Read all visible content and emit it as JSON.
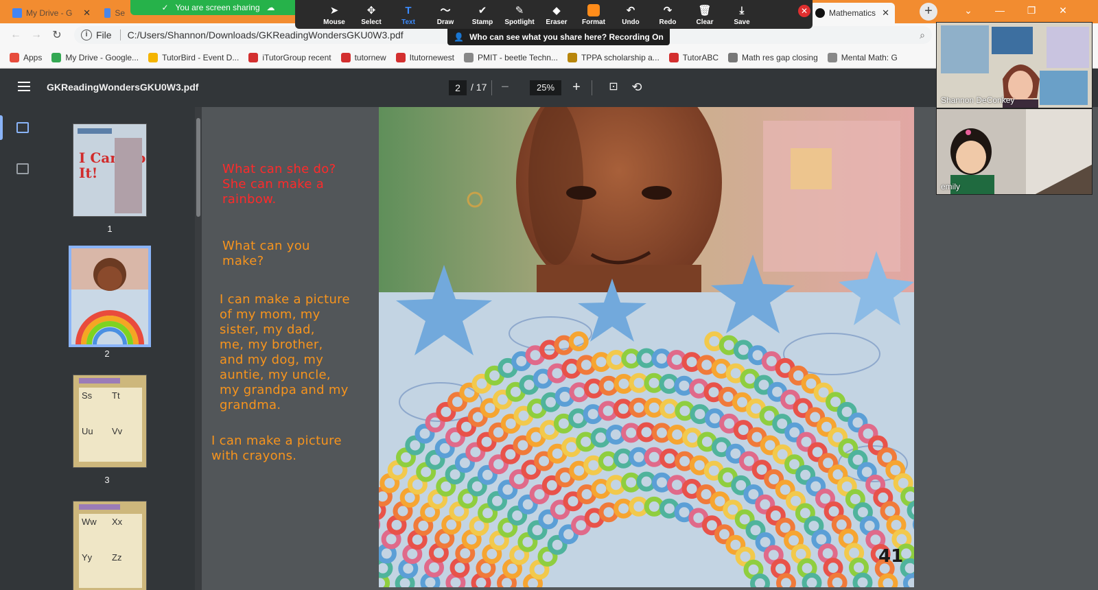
{
  "browser": {
    "tabs": [
      {
        "label": "My Drive - G",
        "color": "#4285f4"
      },
      {
        "label": "Se",
        "color": "#4a86e8"
      },
      {
        "label": "Mathematics",
        "color": "#111111"
      }
    ],
    "url_prefix": "File",
    "url": "C:/Users/Shannon/Downloads/GKReadingWondersGKU0W3.pdf",
    "bookmarks": [
      {
        "label": "Apps",
        "color": "#e74c3c"
      },
      {
        "label": "My Drive - Google...",
        "color": "#34a853"
      },
      {
        "label": "TutorBird - Event D...",
        "color": "#f4b400"
      },
      {
        "label": "iTutorGroup recent",
        "color": "#d32f2f"
      },
      {
        "label": "tutornew",
        "color": "#d32f2f"
      },
      {
        "label": "Itutornewest",
        "color": "#d32f2f"
      },
      {
        "label": "PMIT - beetle Techn...",
        "color": "#888888"
      },
      {
        "label": "TPPA scholarship a...",
        "color": "#b8860b"
      },
      {
        "label": "TutorABC",
        "color": "#d32f2f"
      },
      {
        "label": "Math res gap closing",
        "color": "#777777"
      },
      {
        "label": "Mental Math: G",
        "color": "#888888"
      }
    ]
  },
  "zoom": {
    "share_status": "You are screen sharing",
    "recording_notice": "Who can see what you share here? Recording On",
    "tools": [
      {
        "label": "Mouse",
        "glyph": "➤"
      },
      {
        "label": "Select",
        "glyph": "✥"
      },
      {
        "label": "Text",
        "glyph": "T"
      },
      {
        "label": "Draw",
        "glyph": "〜"
      },
      {
        "label": "Stamp",
        "glyph": "✔"
      },
      {
        "label": "Spotlight",
        "glyph": "✎"
      },
      {
        "label": "Eraser",
        "glyph": "◆"
      },
      {
        "label": "Format",
        "glyph": ""
      },
      {
        "label": "Undo",
        "glyph": "↶"
      },
      {
        "label": "Redo",
        "glyph": "↷"
      },
      {
        "label": "Clear",
        "glyph": "🗑"
      },
      {
        "label": "Save",
        "glyph": "⤓"
      }
    ]
  },
  "pdf": {
    "title": "GKReadingWondersGKU0W3.pdf",
    "page_current": "2",
    "page_total": "/ 17",
    "zoom_level": "25%",
    "thumbnails": [
      "1",
      "2",
      "3"
    ],
    "thumb1_title": "I Can Do It!",
    "thumb3_letters": [
      "Ss",
      "Tt",
      "Uu",
      "Vv"
    ],
    "thumb4_letters": [
      "Ww",
      "Xx",
      "Yy",
      "Zz"
    ],
    "page_number_on_page": "41"
  },
  "annotations": {
    "note1": "What can she do?\nShe can make a\nrainbow.",
    "note2": "What can you\nmake?",
    "note3": "I can make a picture\nof my mom, my\nsister, my dad,\nme, my brother,\nand my dog, my\nauntie, my uncle,\nmy grandpa and my\ngrandma.",
    "note4": "I can make a picture\nwith crayons."
  },
  "participants": [
    {
      "name": "Shannon DeConkey"
    },
    {
      "name": "emily"
    }
  ]
}
